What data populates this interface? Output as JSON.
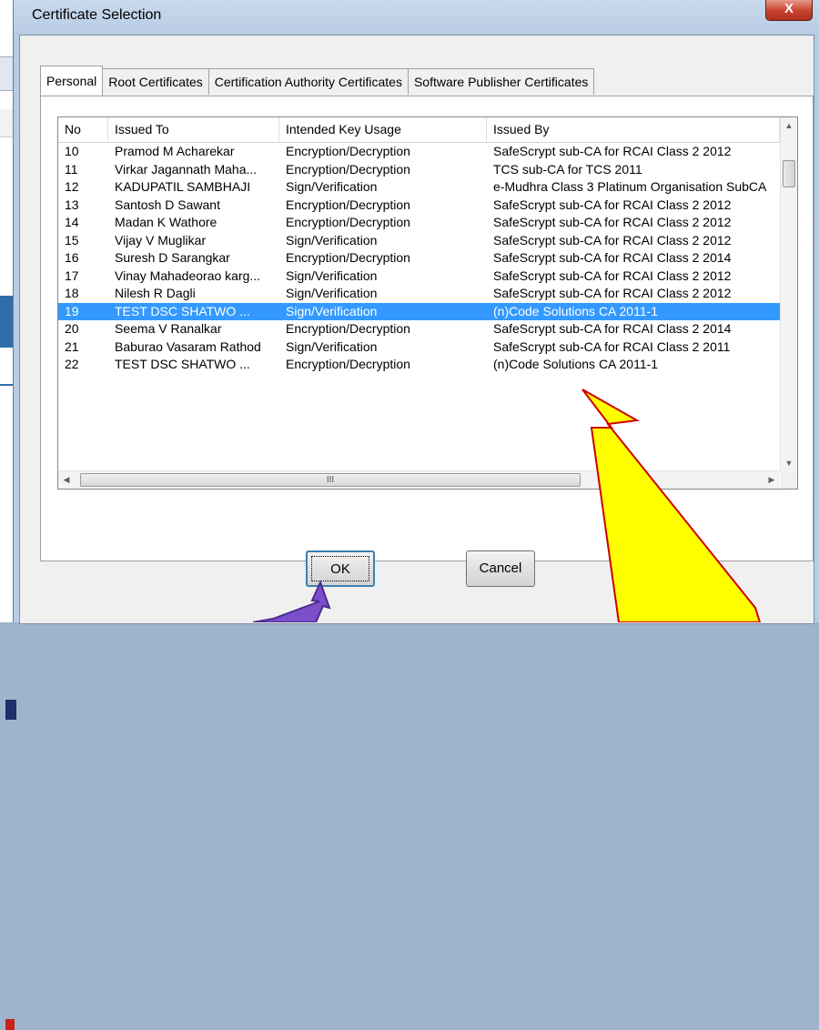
{
  "window": {
    "title": "Certificate Selection",
    "close_label": "X"
  },
  "tabs": [
    {
      "label": "Personal",
      "active": true
    },
    {
      "label": "Root Certificates",
      "active": false
    },
    {
      "label": "Certification Authority Certificates",
      "active": false
    },
    {
      "label": "Software Publisher Certificates",
      "active": false
    }
  ],
  "table": {
    "columns": [
      "No",
      "Issued To",
      "Intended Key Usage",
      "Issued By"
    ],
    "selected_no": "19",
    "rows": [
      {
        "no": "10",
        "issued_to": "Pramod M Acharekar",
        "usage": "Encryption/Decryption",
        "issued_by": "SafeScrypt sub-CA for RCAI Class 2 2012"
      },
      {
        "no": "11",
        "issued_to": "Virkar Jagannath Maha...",
        "usage": "Encryption/Decryption",
        "issued_by": "TCS sub-CA for TCS 2011"
      },
      {
        "no": "12",
        "issued_to": "KADUPATIL SAMBHAJI",
        "usage": "Sign/Verification",
        "issued_by": "e-Mudhra Class 3 Platinum Organisation SubCA"
      },
      {
        "no": "13",
        "issued_to": "Santosh D Sawant",
        "usage": "Encryption/Decryption",
        "issued_by": "SafeScrypt sub-CA for RCAI Class 2 2012"
      },
      {
        "no": "14",
        "issued_to": "Madan K Wathore",
        "usage": "Encryption/Decryption",
        "issued_by": "SafeScrypt sub-CA for RCAI Class 2 2012"
      },
      {
        "no": "15",
        "issued_to": "Vijay V Muglikar",
        "usage": "Sign/Verification",
        "issued_by": "SafeScrypt sub-CA for RCAI Class 2 2012"
      },
      {
        "no": "16",
        "issued_to": "Suresh D Sarangkar",
        "usage": "Encryption/Decryption",
        "issued_by": "SafeScrypt sub-CA for RCAI Class 2 2014"
      },
      {
        "no": "17",
        "issued_to": "Vinay Mahadeorao karg...",
        "usage": "Sign/Verification",
        "issued_by": "SafeScrypt sub-CA for RCAI Class 2 2012"
      },
      {
        "no": "18",
        "issued_to": "Nilesh R Dagli",
        "usage": "Sign/Verification",
        "issued_by": "SafeScrypt sub-CA for RCAI Class 2 2012"
      },
      {
        "no": "19",
        "issued_to": "TEST DSC SHATWO ...",
        "usage": "Sign/Verification",
        "issued_by": "(n)Code Solutions CA 2011-1"
      },
      {
        "no": "20",
        "issued_to": "Seema V Ranalkar",
        "usage": "Encryption/Decryption",
        "issued_by": "SafeScrypt sub-CA for RCAI Class 2 2014"
      },
      {
        "no": "21",
        "issued_to": "Baburao Vasaram Rathod",
        "usage": "Sign/Verification",
        "issued_by": "SafeScrypt sub-CA for RCAI Class 2 2011"
      },
      {
        "no": "22",
        "issued_to": "TEST DSC SHATWO ...",
        "usage": "Encryption/Decryption",
        "issued_by": "(n)Code Solutions CA 2011-1"
      }
    ]
  },
  "scroll": {
    "h_thumb_grip": "III"
  },
  "buttons": {
    "ok_label": "OK",
    "cancel_label": "Cancel"
  },
  "annotations": {
    "yellow_arrow_color": "#ffff00",
    "purple_arrow_color": "#7b4fc9"
  },
  "colors": {
    "selection": "#3399ff",
    "close_button": "#c7402c"
  }
}
